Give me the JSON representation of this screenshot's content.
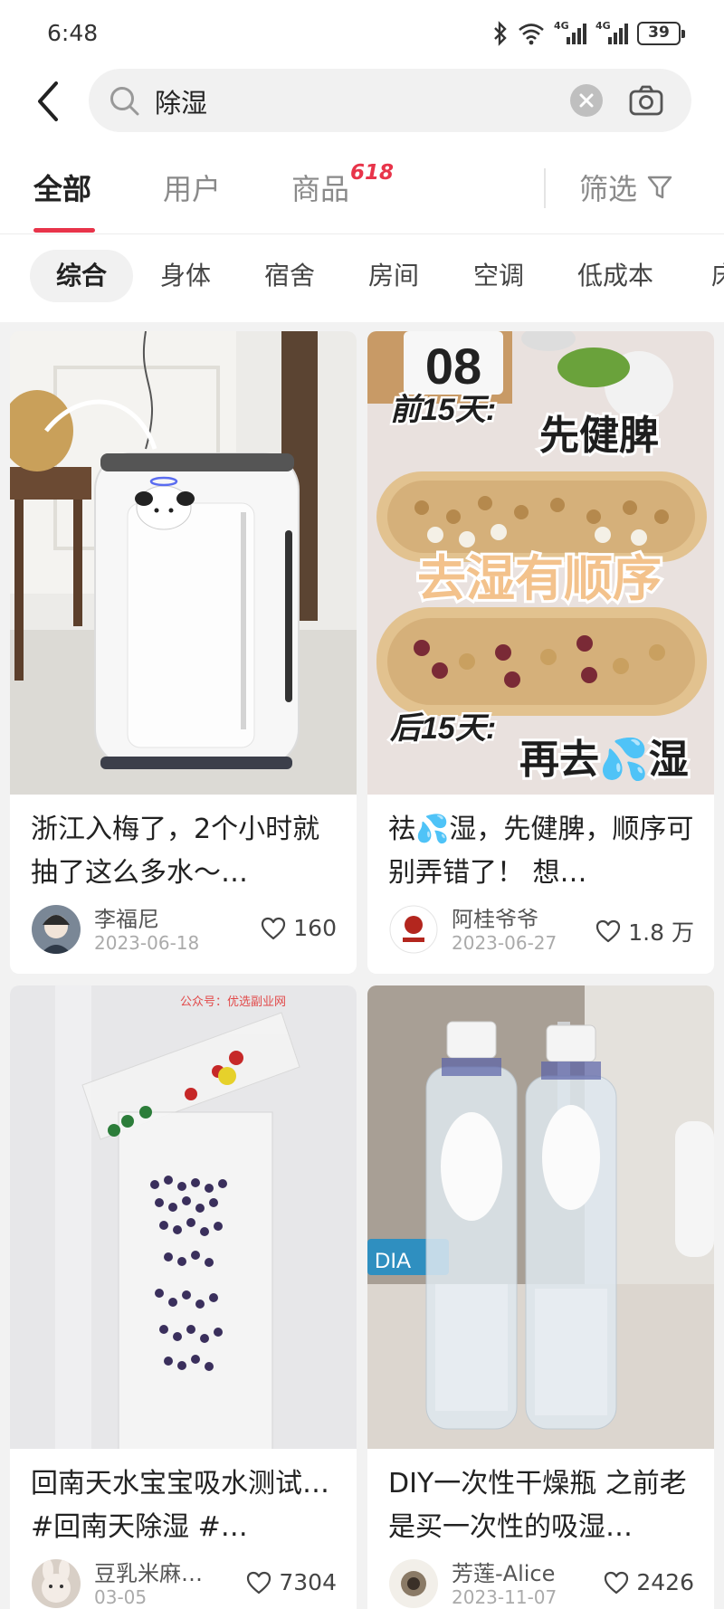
{
  "status_bar": {
    "time": "6:48",
    "network_1": "4G",
    "network_2": "4G",
    "battery": "39"
  },
  "search": {
    "query": "除湿"
  },
  "tabs": [
    {
      "label": "全部",
      "active": true
    },
    {
      "label": "用户",
      "active": false
    },
    {
      "label": "商品",
      "active": false,
      "badge": "618"
    }
  ],
  "filter_label": "筛选",
  "sub_tabs": [
    {
      "label": "综合",
      "active": true
    },
    {
      "label": "身体"
    },
    {
      "label": "宿舍"
    },
    {
      "label": "房间"
    },
    {
      "label": "空调"
    },
    {
      "label": "低成本"
    },
    {
      "label": "床"
    }
  ],
  "posts": [
    {
      "title": "浙江入梅了，2个小时就抽了这么多水～…",
      "author": "李福尼",
      "date": "2023-06-18",
      "likes": "160",
      "image_icon": "dehumidifier-photo"
    },
    {
      "title": "祛💦湿，先健脾，顺序可别弄错了！ 想…",
      "author": "阿桂爷爷",
      "date": "2023-06-27",
      "likes": "1.8 万",
      "image_icon": "herbal-trays-photo",
      "image_text": {
        "calendar": "08",
        "line1_left": "前15天:",
        "line1_right": "先健脾",
        "middle": "去湿有顺序",
        "line2_left": "后15天:",
        "line2_right": "再去💦湿"
      }
    },
    {
      "title": "回南天水宝宝吸水测试…#回南天除湿 #…",
      "author": "豆乳米麻…",
      "date": "03-05",
      "likes": "7304",
      "image_icon": "water-beads-photo",
      "image_text": {
        "watermark": "公众号：优选副业网"
      }
    },
    {
      "title": "DIY一次性干燥瓶 之前老是买一次性的吸湿…",
      "author": "芳莲-Alice",
      "date": "2023-11-07",
      "likes": "2426",
      "image_icon": "desiccant-bottles-photo",
      "image_text": {
        "box_label": "DIA"
      }
    }
  ],
  "colors": {
    "accent": "#e8344a",
    "page_bg": "#f2f2f2",
    "card_bg": "#ffffff"
  }
}
